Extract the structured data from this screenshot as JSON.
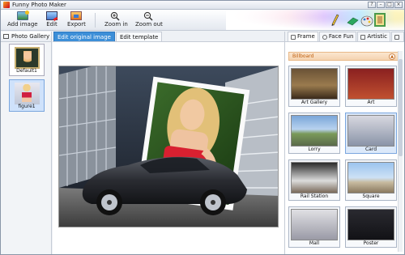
{
  "window": {
    "title": "Funny Photo Maker"
  },
  "toolbar": {
    "buttons": [
      {
        "label": "Add image",
        "icon": "add-image-icon"
      },
      {
        "label": "Edit",
        "icon": "edit-icon"
      },
      {
        "label": "Export",
        "icon": "export-icon"
      },
      {
        "label": "Zoom in",
        "icon": "zoom-in-icon"
      },
      {
        "label": "Zoom out",
        "icon": "zoom-out-icon"
      }
    ]
  },
  "left_panel": {
    "tab_label": "Photo Gallery",
    "items": [
      {
        "label": "Default1",
        "selected": false
      },
      {
        "label": "figure1",
        "selected": true
      }
    ]
  },
  "center": {
    "tabs": [
      {
        "label": "Edit original image",
        "active": true
      },
      {
        "label": "Edit template",
        "active": false
      }
    ]
  },
  "right_panel": {
    "tabs": [
      {
        "label": "Frame",
        "active": true
      },
      {
        "label": "Face Fun",
        "active": false
      },
      {
        "label": "Artistic",
        "active": false
      }
    ],
    "category": "Billboard",
    "templates": [
      {
        "label": "Art Gallery",
        "selected": false
      },
      {
        "label": "Art",
        "selected": false
      },
      {
        "label": "Lorry",
        "selected": false
      },
      {
        "label": "Card",
        "selected": true
      },
      {
        "label": "Rail Station",
        "selected": false
      },
      {
        "label": "Square",
        "selected": false
      },
      {
        "label": "Mall",
        "selected": false
      },
      {
        "label": "Poster",
        "selected": false
      }
    ]
  },
  "colors": {
    "accent_tab": "#3d8fd8",
    "selection": "#cfe2fb",
    "category_text": "#c06010"
  }
}
